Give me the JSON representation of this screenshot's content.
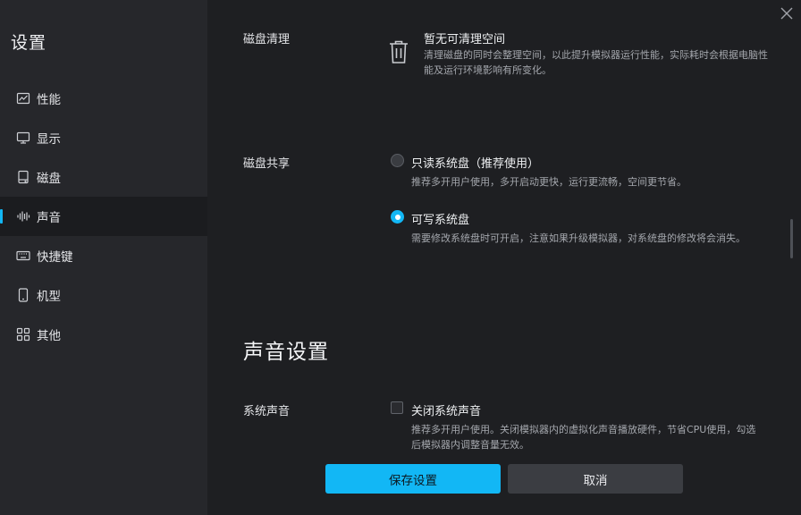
{
  "sidebar": {
    "title": "设置",
    "items": [
      {
        "label": "性能",
        "icon": "chart-line-icon"
      },
      {
        "label": "显示",
        "icon": "monitor-icon"
      },
      {
        "label": "磁盘",
        "icon": "disk-icon"
      },
      {
        "label": "声音",
        "icon": "sound-wave-icon",
        "active": true
      },
      {
        "label": "快捷键",
        "icon": "keyboard-icon"
      },
      {
        "label": "机型",
        "icon": "phone-icon"
      },
      {
        "label": "其他",
        "icon": "grid-icon"
      }
    ]
  },
  "disk_cleanup": {
    "label": "磁盘清理",
    "title": "暂无可清理空间",
    "description": "清理磁盘的同时会整理空间，以此提升模拟器运行性能，实际耗时会根据电脑性能及运行环境影响有所变化。"
  },
  "disk_share": {
    "label": "磁盘共享",
    "options": [
      {
        "label": "只读系统盘（推荐使用）",
        "description": "推荐多开用户使用，多开启动更快，运行更流畅，空间更节省。",
        "selected": false
      },
      {
        "label": "可写系统盘",
        "description": "需要修改系统盘时可开启，注意如果升级模拟器，对系统盘的修改将会消失。",
        "selected": true
      }
    ]
  },
  "sound_section": {
    "title": "声音设置",
    "system_sound": {
      "label": "系统声音",
      "checkbox_label": "关闭系统声音",
      "checked": false,
      "description": "推荐多开用户使用。关闭模拟器内的虚拟化声音播放硬件，节省CPU使用，勾选后模拟器内调整音量无效。"
    }
  },
  "footer": {
    "save_label": "保存设置",
    "cancel_label": "取消"
  },
  "colors": {
    "accent": "#12b7f5",
    "sidebar_bg": "#26272b",
    "main_bg": "#1e1f22"
  }
}
